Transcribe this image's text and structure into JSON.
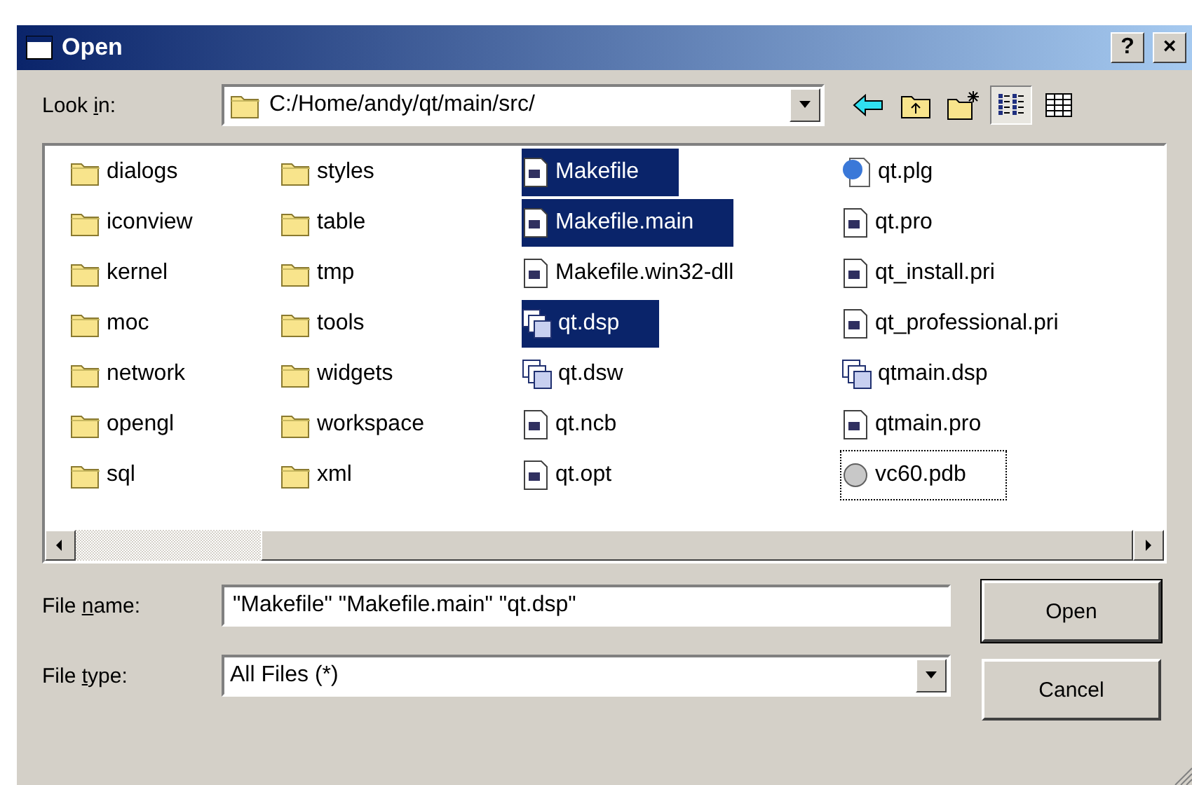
{
  "window": {
    "title": "Open",
    "title_buttons": [
      "?",
      "×"
    ]
  },
  "look_in": {
    "label_parts": [
      "Look ",
      "i",
      "n:"
    ],
    "value": "C:/Home/andy/qt/main/src/"
  },
  "toolbar": [
    {
      "kind": "back",
      "selected": false
    },
    {
      "kind": "up",
      "selected": false
    },
    {
      "kind": "new-folder",
      "selected": false
    },
    {
      "kind": "list",
      "selected": true
    },
    {
      "kind": "details",
      "selected": false
    }
  ],
  "files": [
    {
      "name": "dialogs",
      "kind": "folder",
      "selected": false,
      "focused": false
    },
    {
      "name": "iconview",
      "kind": "folder",
      "selected": false,
      "focused": false
    },
    {
      "name": "kernel",
      "kind": "folder",
      "selected": false,
      "focused": false
    },
    {
      "name": "moc",
      "kind": "folder",
      "selected": false,
      "focused": false
    },
    {
      "name": "network",
      "kind": "folder",
      "selected": false,
      "focused": false
    },
    {
      "name": "opengl",
      "kind": "folder",
      "selected": false,
      "focused": false
    },
    {
      "name": "sql",
      "kind": "folder",
      "selected": false,
      "focused": false
    },
    {
      "name": "styles",
      "kind": "folder",
      "selected": false,
      "focused": false
    },
    {
      "name": "table",
      "kind": "folder",
      "selected": false,
      "focused": false
    },
    {
      "name": "tmp",
      "kind": "folder",
      "selected": false,
      "focused": false
    },
    {
      "name": "tools",
      "kind": "folder",
      "selected": false,
      "focused": false
    },
    {
      "name": "widgets",
      "kind": "folder",
      "selected": false,
      "focused": false
    },
    {
      "name": "workspace",
      "kind": "folder",
      "selected": false,
      "focused": false
    },
    {
      "name": "xml",
      "kind": "folder",
      "selected": false,
      "focused": false
    },
    {
      "name": "Makefile",
      "kind": "text",
      "selected": true,
      "focused": false
    },
    {
      "name": "Makefile.main",
      "kind": "text",
      "selected": true,
      "focused": false
    },
    {
      "name": "Makefile.win32-dll",
      "kind": "text",
      "selected": false,
      "focused": false
    },
    {
      "name": "qt.dsp",
      "kind": "project",
      "selected": true,
      "focused": false
    },
    {
      "name": "qt.dsw",
      "kind": "project",
      "selected": false,
      "focused": false
    },
    {
      "name": "qt.ncb",
      "kind": "text",
      "selected": false,
      "focused": false
    },
    {
      "name": "qt.opt",
      "kind": "text",
      "selected": false,
      "focused": false
    },
    {
      "name": "qt.plg",
      "kind": "web",
      "selected": false,
      "focused": false
    },
    {
      "name": "qt.pro",
      "kind": "text",
      "selected": false,
      "focused": false
    },
    {
      "name": "qt_install.pri",
      "kind": "text",
      "selected": false,
      "focused": false
    },
    {
      "name": "qt_professional.pri",
      "kind": "text",
      "selected": false,
      "focused": false
    },
    {
      "name": "qtmain.dsp",
      "kind": "project",
      "selected": false,
      "focused": false
    },
    {
      "name": "qtmain.pro",
      "kind": "text",
      "selected": false,
      "focused": false
    },
    {
      "name": "vc60.pdb",
      "kind": "data",
      "selected": false,
      "focused": true
    }
  ],
  "file_name": {
    "label_parts": [
      "File ",
      "n",
      "ame:"
    ],
    "value": "\"Makefile\" \"Makefile.main\" \"qt.dsp\""
  },
  "file_type": {
    "label_parts": [
      "File ",
      "t",
      "ype:"
    ],
    "value": "All Files (*)"
  },
  "buttons": [
    "Open",
    "Cancel"
  ]
}
